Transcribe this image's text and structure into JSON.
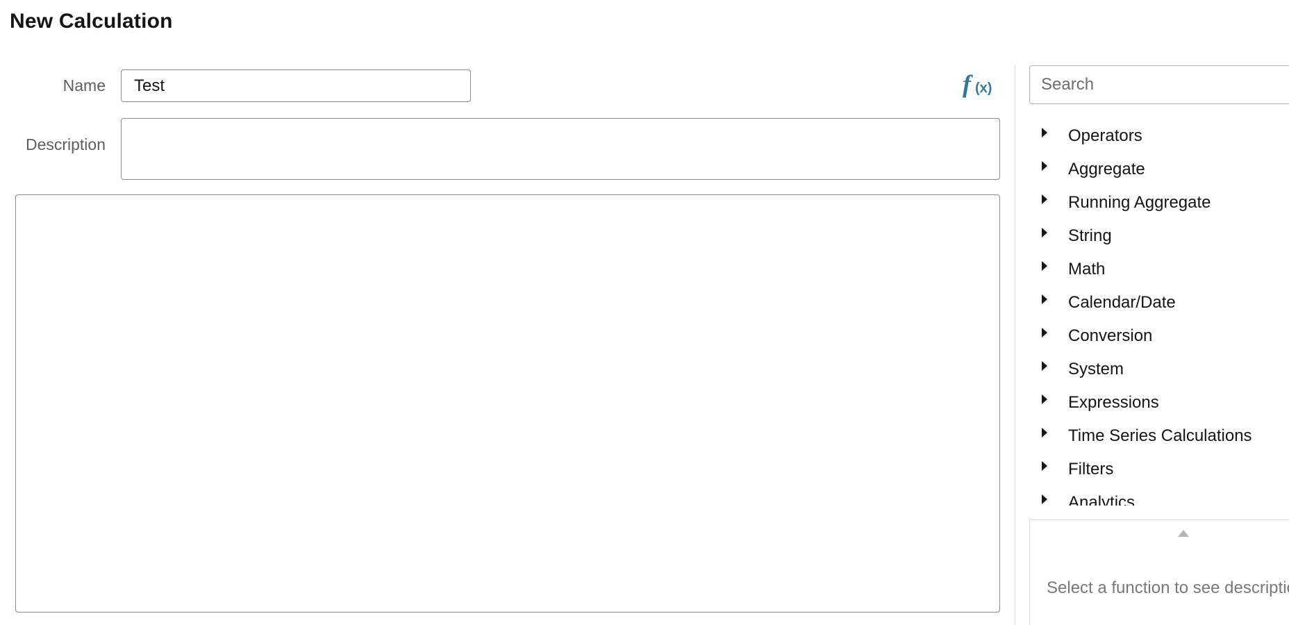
{
  "dialog": {
    "title": "New Calculation"
  },
  "form": {
    "name_label": "Name",
    "name_value": "Test",
    "description_label": "Description",
    "description_value": ""
  },
  "toolbar": {
    "fx_icon": "function-fx-icon",
    "fx_f": "f",
    "fx_x": "(x)"
  },
  "functions": {
    "search_placeholder": "Search",
    "items": [
      {
        "label": "Operators"
      },
      {
        "label": "Aggregate"
      },
      {
        "label": "Running Aggregate"
      },
      {
        "label": "String"
      },
      {
        "label": "Math"
      },
      {
        "label": "Calendar/Date"
      },
      {
        "label": "Conversion"
      },
      {
        "label": "System"
      },
      {
        "label": "Expressions"
      },
      {
        "label": "Time Series Calculations"
      },
      {
        "label": "Filters"
      },
      {
        "label": "Analytics"
      }
    ],
    "description_hint": "Select a function to see description"
  },
  "colors": {
    "accent": "#2f7a9c",
    "border": "#8b8985",
    "text": "#161513",
    "muted_text": "#5f5e5b"
  }
}
